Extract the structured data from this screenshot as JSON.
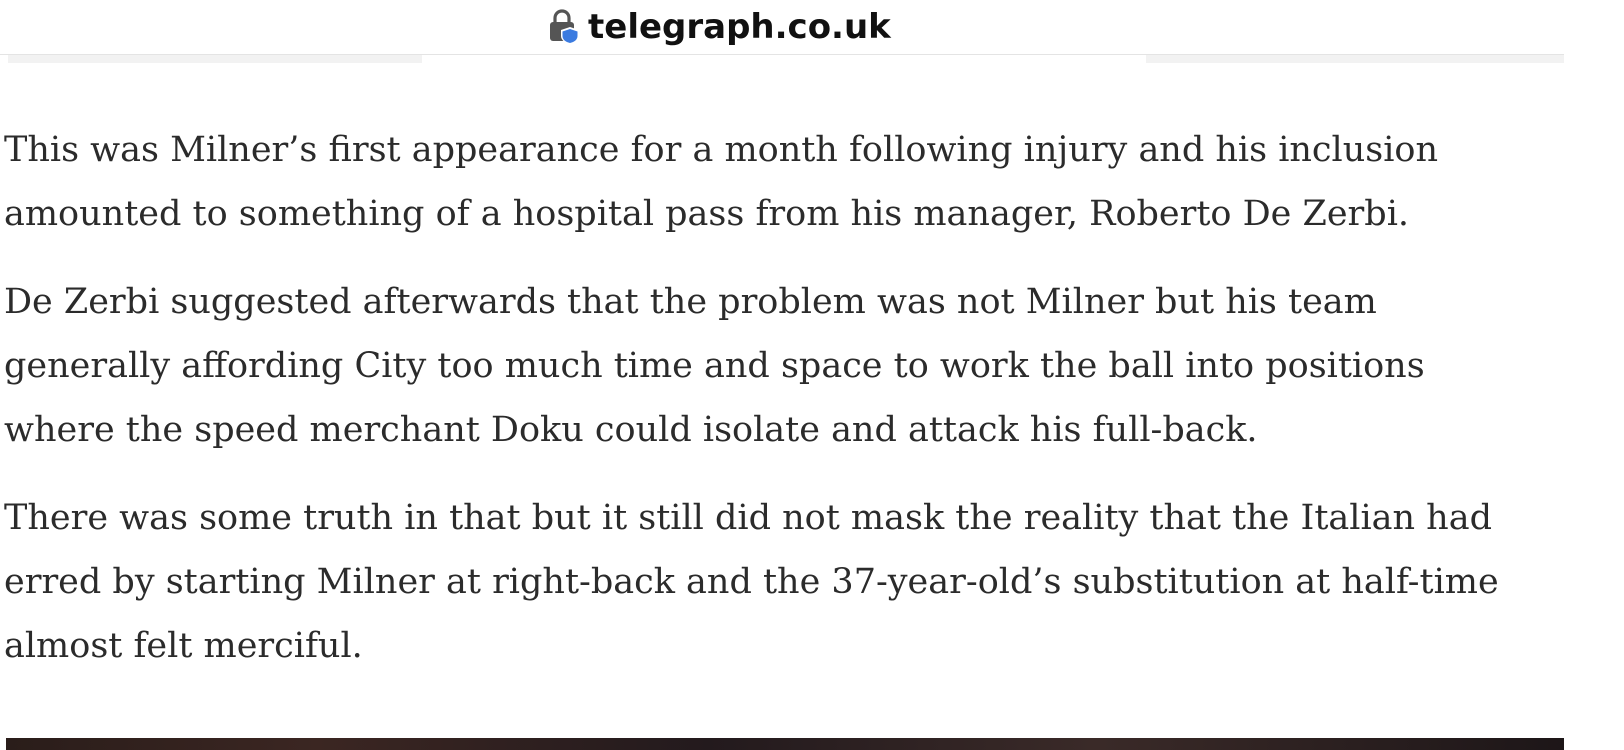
{
  "browser": {
    "domain": "telegraph.co.uk",
    "lock_icon": "lock-shield-icon"
  },
  "article": {
    "paragraphs": [
      "This was Milner’s first appearance for a month following injury and his inclusion\namounted to something of a hospital pass from his manager, Roberto De Zerbi.",
      "De Zerbi suggested afterwards that the problem was not Milner but his team\ngenerally affording City too much time and space to work the ball into positions\nwhere the speed merchant Doku could isolate and attack his full-back.",
      "There was some truth in that but it still did not mask the reality that the Italian had\nerred by starting Milner at right-back and the 37-year-old’s substitution at half-time\nalmost felt merciful."
    ]
  },
  "colors": {
    "text": "#2b2b2b",
    "shield": "#3b7be0",
    "lock_body": "#555555"
  }
}
